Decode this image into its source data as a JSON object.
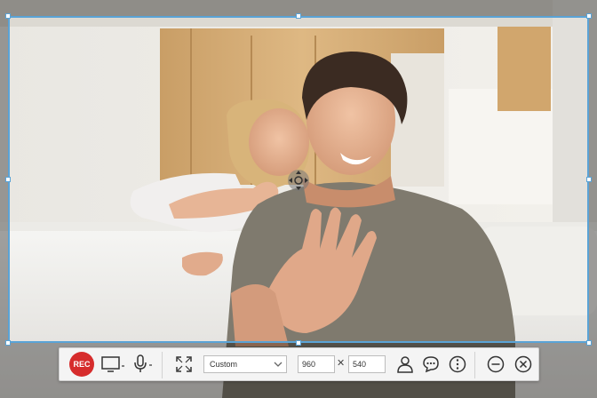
{
  "toolbar": {
    "rec_label": "REC",
    "preset_value": "Custom",
    "width_value": "960",
    "times_sign": "✕",
    "height_value": "540"
  },
  "icons": {
    "monitor": "monitor-icon",
    "microphone": "microphone-icon",
    "fullscreen": "fullscreen-expand-icon",
    "webcam": "webcam-user-icon",
    "chat": "chat-bubble-icon",
    "more": "more-options-icon",
    "minimize": "minimize-icon",
    "close": "close-icon",
    "move": "move-arrows-icon"
  },
  "colors": {
    "selection": "#5aa3d6",
    "rec": "#d62c2c",
    "toolbar": "#f4f4f4"
  }
}
